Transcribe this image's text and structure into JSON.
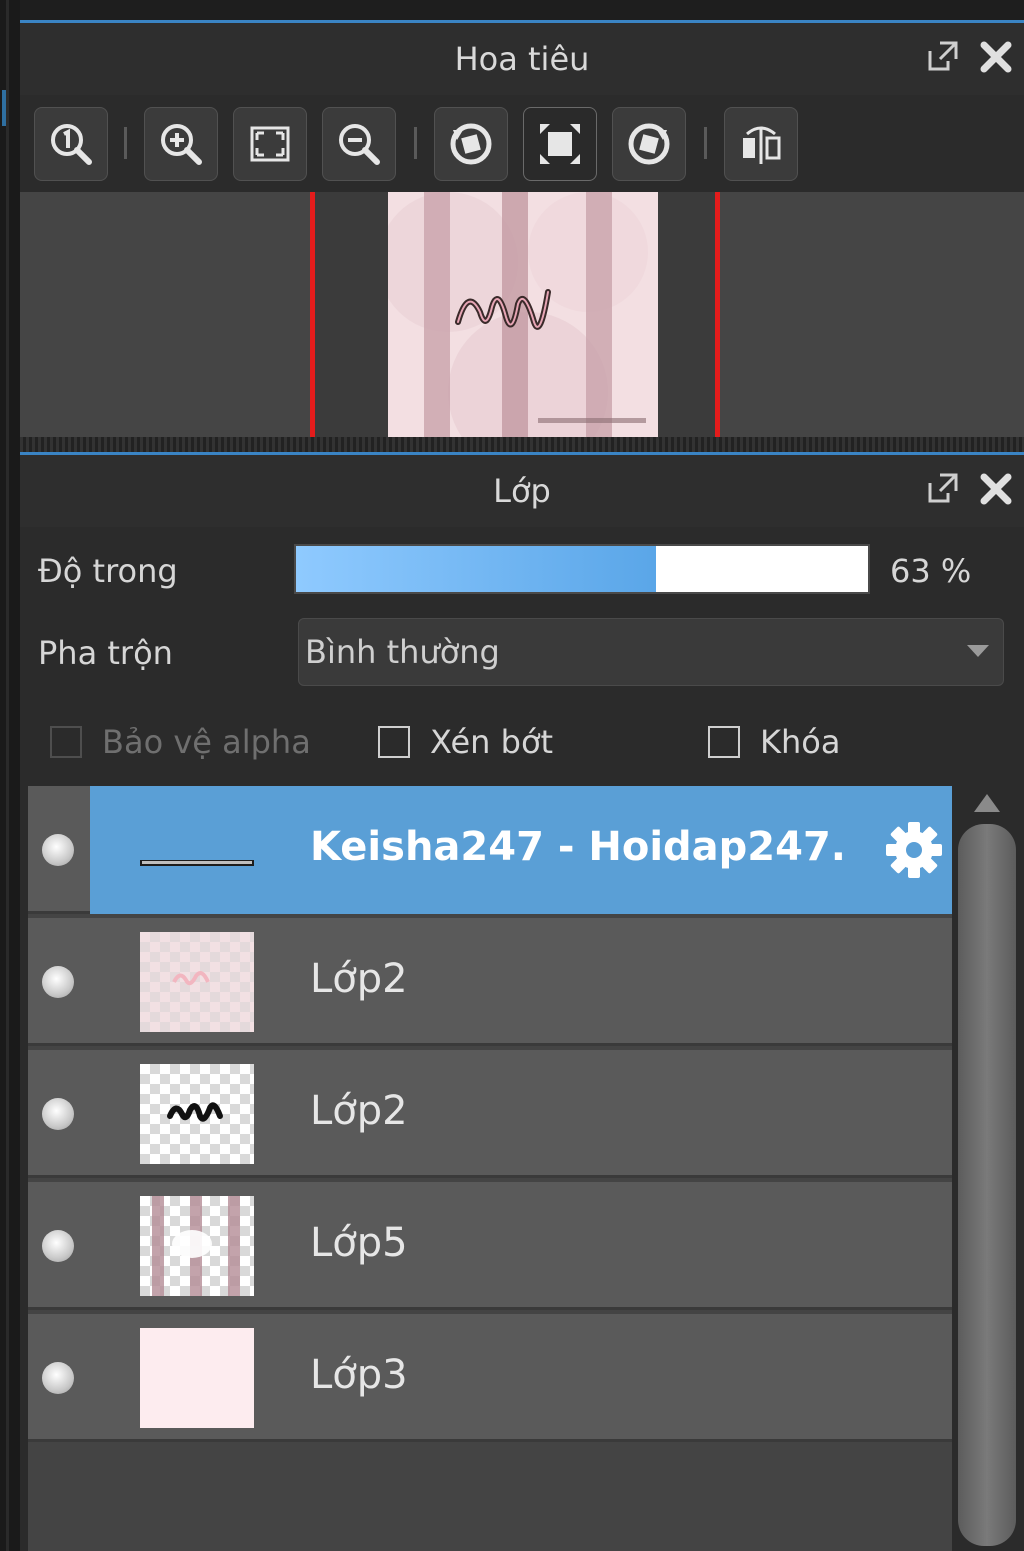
{
  "navigator": {
    "title": "Hoa tiêu"
  },
  "layers_panel": {
    "title": "Lớp",
    "opacity_label": "Độ trong",
    "opacity_value": "63 %",
    "opacity_fraction": 0.63,
    "blend_label": "Pha trộn",
    "blend_value": "Bình thường",
    "protect_alpha_label": "Bảo vệ alpha",
    "clipping_label": "Xén bớt",
    "lock_label": "Khóa",
    "layers": [
      {
        "name": "Keisha247 - Hoidap247.",
        "selected": true
      },
      {
        "name": "Lớp2",
        "selected": false
      },
      {
        "name": "Lớp2",
        "selected": false
      },
      {
        "name": "Lớp5",
        "selected": false
      },
      {
        "name": "Lớp3",
        "selected": false
      }
    ]
  },
  "colors": {
    "accent": "#3a84c4",
    "selected_row": "#5a9fd6",
    "frame_red": "#e41c1c"
  }
}
